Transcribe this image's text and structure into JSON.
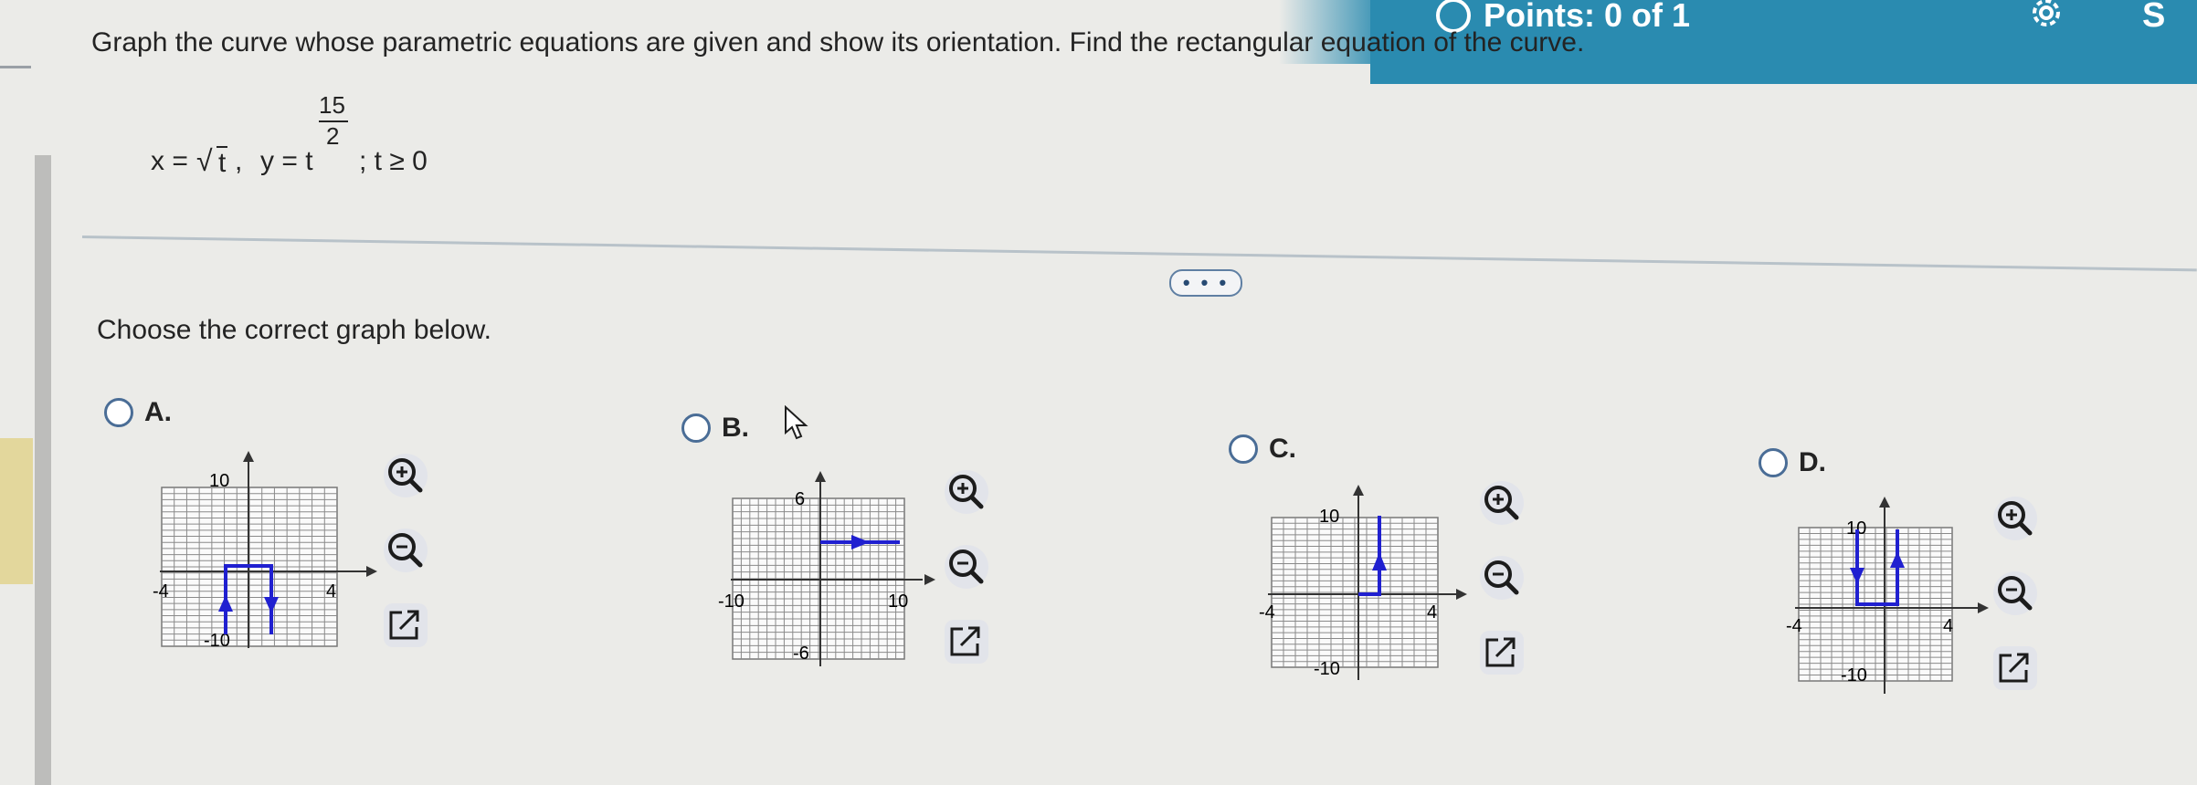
{
  "header": {
    "points_label": "Points: 0 of 1",
    "corner_label": "S",
    "settings_icon": "gear-icon"
  },
  "question": {
    "text": "Graph the curve whose parametric equations are given and show its orientation. Find the rectangular equation of the curve.",
    "equation": {
      "x_lhs": "x =",
      "sqrt_sign": "√",
      "sqrt_arg": "t",
      "comma": ",",
      "y_lhs": "y = t",
      "exp_num": "15",
      "exp_den": "2",
      "condition": "; t ≥ 0"
    }
  },
  "more_button": "• • •",
  "prompt": "Choose the correct graph below.",
  "colors": {
    "accent": "#2a8bb0",
    "radio": "#4a6d96",
    "curve": "#2020d0"
  },
  "options": [
    {
      "id": "A",
      "label": "A.",
      "tick_top": "10",
      "tick_left": "-4",
      "tick_right": "4",
      "tick_bottom": "-10",
      "tools": [
        "zoom-in-icon",
        "zoom-out-icon",
        "open-external-icon"
      ]
    },
    {
      "id": "B",
      "label": "B.",
      "tick_top": "6",
      "tick_left": "-10",
      "tick_right": "10",
      "tick_bottom": "-6",
      "tools": [
        "zoom-in-icon",
        "zoom-out-icon",
        "open-external-icon"
      ]
    },
    {
      "id": "C",
      "label": "C.",
      "tick_top": "10",
      "tick_left": "-4",
      "tick_right": "4",
      "tick_bottom": "-10",
      "tools": [
        "zoom-in-icon",
        "zoom-out-icon",
        "open-external-icon"
      ]
    },
    {
      "id": "D",
      "label": "D.",
      "tick_top": "10",
      "tick_left": "-4",
      "tick_right": "4",
      "tick_bottom": "-10",
      "tools": [
        "zoom-in-icon",
        "zoom-out-icon",
        "open-external-icon"
      ]
    }
  ]
}
